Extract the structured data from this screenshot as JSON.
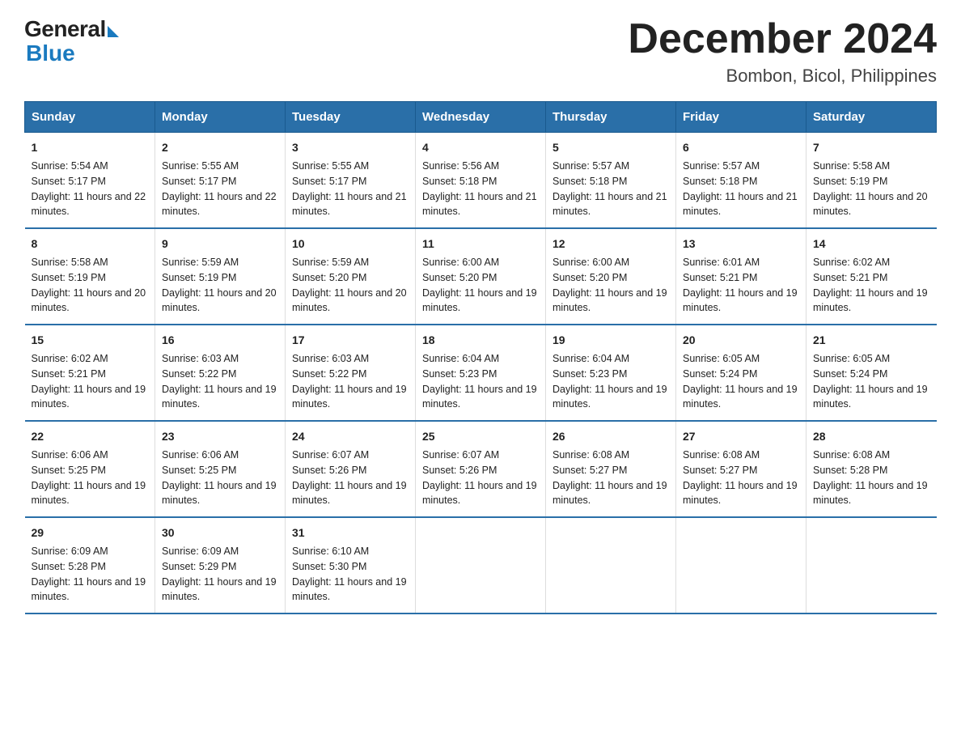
{
  "logo": {
    "general": "General",
    "blue": "Blue"
  },
  "title": "December 2024",
  "subtitle": "Bombon, Bicol, Philippines",
  "headers": [
    "Sunday",
    "Monday",
    "Tuesday",
    "Wednesday",
    "Thursday",
    "Friday",
    "Saturday"
  ],
  "weeks": [
    [
      {
        "day": "1",
        "sunrise": "5:54 AM",
        "sunset": "5:17 PM",
        "daylight": "11 hours and 22 minutes."
      },
      {
        "day": "2",
        "sunrise": "5:55 AM",
        "sunset": "5:17 PM",
        "daylight": "11 hours and 22 minutes."
      },
      {
        "day": "3",
        "sunrise": "5:55 AM",
        "sunset": "5:17 PM",
        "daylight": "11 hours and 21 minutes."
      },
      {
        "day": "4",
        "sunrise": "5:56 AM",
        "sunset": "5:18 PM",
        "daylight": "11 hours and 21 minutes."
      },
      {
        "day": "5",
        "sunrise": "5:57 AM",
        "sunset": "5:18 PM",
        "daylight": "11 hours and 21 minutes."
      },
      {
        "day": "6",
        "sunrise": "5:57 AM",
        "sunset": "5:18 PM",
        "daylight": "11 hours and 21 minutes."
      },
      {
        "day": "7",
        "sunrise": "5:58 AM",
        "sunset": "5:19 PM",
        "daylight": "11 hours and 20 minutes."
      }
    ],
    [
      {
        "day": "8",
        "sunrise": "5:58 AM",
        "sunset": "5:19 PM",
        "daylight": "11 hours and 20 minutes."
      },
      {
        "day": "9",
        "sunrise": "5:59 AM",
        "sunset": "5:19 PM",
        "daylight": "11 hours and 20 minutes."
      },
      {
        "day": "10",
        "sunrise": "5:59 AM",
        "sunset": "5:20 PM",
        "daylight": "11 hours and 20 minutes."
      },
      {
        "day": "11",
        "sunrise": "6:00 AM",
        "sunset": "5:20 PM",
        "daylight": "11 hours and 19 minutes."
      },
      {
        "day": "12",
        "sunrise": "6:00 AM",
        "sunset": "5:20 PM",
        "daylight": "11 hours and 19 minutes."
      },
      {
        "day": "13",
        "sunrise": "6:01 AM",
        "sunset": "5:21 PM",
        "daylight": "11 hours and 19 minutes."
      },
      {
        "day": "14",
        "sunrise": "6:02 AM",
        "sunset": "5:21 PM",
        "daylight": "11 hours and 19 minutes."
      }
    ],
    [
      {
        "day": "15",
        "sunrise": "6:02 AM",
        "sunset": "5:21 PM",
        "daylight": "11 hours and 19 minutes."
      },
      {
        "day": "16",
        "sunrise": "6:03 AM",
        "sunset": "5:22 PM",
        "daylight": "11 hours and 19 minutes."
      },
      {
        "day": "17",
        "sunrise": "6:03 AM",
        "sunset": "5:22 PM",
        "daylight": "11 hours and 19 minutes."
      },
      {
        "day": "18",
        "sunrise": "6:04 AM",
        "sunset": "5:23 PM",
        "daylight": "11 hours and 19 minutes."
      },
      {
        "day": "19",
        "sunrise": "6:04 AM",
        "sunset": "5:23 PM",
        "daylight": "11 hours and 19 minutes."
      },
      {
        "day": "20",
        "sunrise": "6:05 AM",
        "sunset": "5:24 PM",
        "daylight": "11 hours and 19 minutes."
      },
      {
        "day": "21",
        "sunrise": "6:05 AM",
        "sunset": "5:24 PM",
        "daylight": "11 hours and 19 minutes."
      }
    ],
    [
      {
        "day": "22",
        "sunrise": "6:06 AM",
        "sunset": "5:25 PM",
        "daylight": "11 hours and 19 minutes."
      },
      {
        "day": "23",
        "sunrise": "6:06 AM",
        "sunset": "5:25 PM",
        "daylight": "11 hours and 19 minutes."
      },
      {
        "day": "24",
        "sunrise": "6:07 AM",
        "sunset": "5:26 PM",
        "daylight": "11 hours and 19 minutes."
      },
      {
        "day": "25",
        "sunrise": "6:07 AM",
        "sunset": "5:26 PM",
        "daylight": "11 hours and 19 minutes."
      },
      {
        "day": "26",
        "sunrise": "6:08 AM",
        "sunset": "5:27 PM",
        "daylight": "11 hours and 19 minutes."
      },
      {
        "day": "27",
        "sunrise": "6:08 AM",
        "sunset": "5:27 PM",
        "daylight": "11 hours and 19 minutes."
      },
      {
        "day": "28",
        "sunrise": "6:08 AM",
        "sunset": "5:28 PM",
        "daylight": "11 hours and 19 minutes."
      }
    ],
    [
      {
        "day": "29",
        "sunrise": "6:09 AM",
        "sunset": "5:28 PM",
        "daylight": "11 hours and 19 minutes."
      },
      {
        "day": "30",
        "sunrise": "6:09 AM",
        "sunset": "5:29 PM",
        "daylight": "11 hours and 19 minutes."
      },
      {
        "day": "31",
        "sunrise": "6:10 AM",
        "sunset": "5:30 PM",
        "daylight": "11 hours and 19 minutes."
      },
      null,
      null,
      null,
      null
    ]
  ]
}
